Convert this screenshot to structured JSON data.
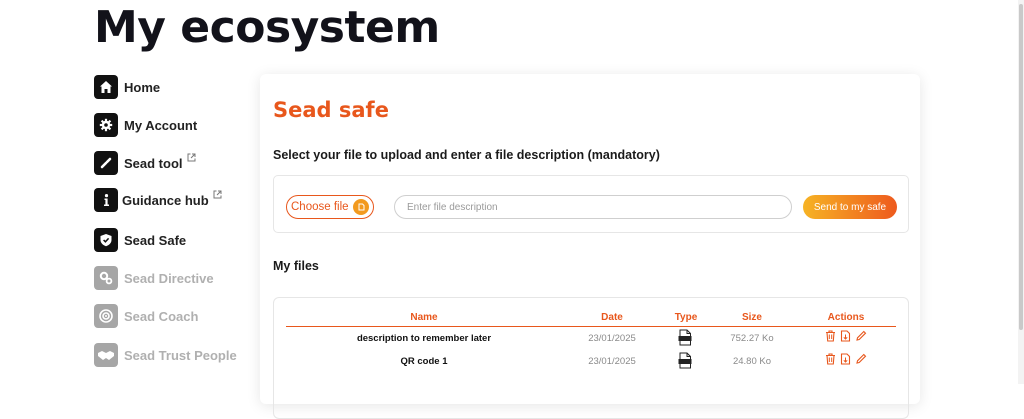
{
  "page": {
    "title": "My ecosystem"
  },
  "sidebar": {
    "items": [
      {
        "label": "Home",
        "icon": "home-icon",
        "disabled": false,
        "external": false
      },
      {
        "label": "My Account",
        "icon": "gear-icon",
        "disabled": false,
        "external": false
      },
      {
        "label": "Sead tool",
        "icon": "tool-icon",
        "disabled": false,
        "external": true
      },
      {
        "label": "Guidance hub",
        "icon": "info-icon",
        "disabled": false,
        "external": true
      },
      {
        "label": "Sead Safe",
        "icon": "shield-icon",
        "disabled": false,
        "external": false
      },
      {
        "label": "Sead Directive",
        "icon": "gears-icon",
        "disabled": true,
        "external": false
      },
      {
        "label": "Sead Coach",
        "icon": "target-icon",
        "disabled": true,
        "external": false
      },
      {
        "label": "Sead Trust People",
        "icon": "handshake-icon",
        "disabled": true,
        "external": false
      }
    ]
  },
  "safe": {
    "title": "Sead safe",
    "upload_heading": "Select your file to upload and enter a file description (mandatory)",
    "choose_file_label": "Choose file",
    "description_placeholder": "Enter file description",
    "description_value": "",
    "send_label": "Send to my safe",
    "files_heading": "My files",
    "table": {
      "headers": {
        "name": "Name",
        "date": "Date",
        "type": "Type",
        "size": "Size",
        "actions": "Actions"
      },
      "rows": [
        {
          "name": "description to remember later",
          "date": "23/01/2025",
          "type": "pdf-file-icon",
          "size": "752.27 Ko"
        },
        {
          "name": "QR code 1",
          "date": "23/01/2025",
          "type": "pdf-file-icon",
          "size": "24.80 Ko"
        }
      ]
    }
  },
  "colors": {
    "accent": "#e8571c",
    "gradient_start": "#f6b324",
    "gradient_end": "#ee5a1e",
    "disabled": "#a6a6a6"
  }
}
